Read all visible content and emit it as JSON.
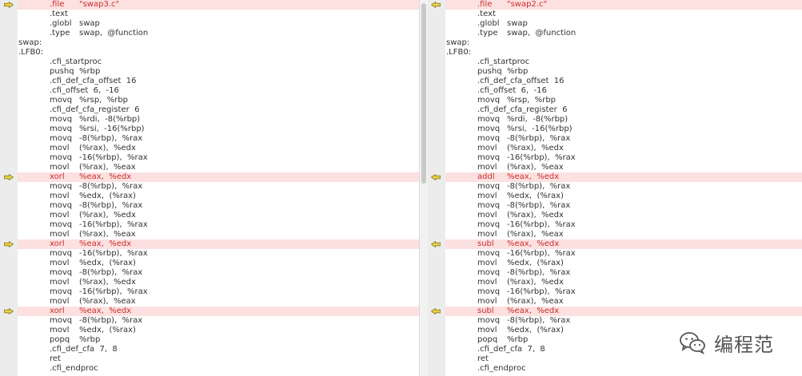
{
  "left_pane": {
    "lines": [
      {
        "l": "",
        "m": ".file",
        "o": "\"swap3.c\"",
        "diff": true
      },
      {
        "l": "",
        "m": ".text",
        "o": "",
        "diff": false
      },
      {
        "l": "",
        "m": ".globl",
        "o": "swap",
        "diff": false
      },
      {
        "l": "",
        "m": ".type",
        "o": "swap,  @function",
        "diff": false
      },
      {
        "l": "swap:",
        "m": "",
        "o": "",
        "diff": false
      },
      {
        "l": ".LFB0:",
        "m": "",
        "o": "",
        "diff": false
      },
      {
        "l": "",
        "m": ".cfi_startproc",
        "o": "",
        "diff": false
      },
      {
        "l": "",
        "m": "pushq",
        "o": "%rbp",
        "diff": false
      },
      {
        "l": "",
        "m": ".cfi_def_cfa_offset  16",
        "o": "",
        "diff": false
      },
      {
        "l": "",
        "m": ".cfi_offset  6,  -16",
        "o": "",
        "diff": false
      },
      {
        "l": "",
        "m": "movq",
        "o": "%rsp,  %rbp",
        "diff": false
      },
      {
        "l": "",
        "m": ".cfi_def_cfa_register  6",
        "o": "",
        "diff": false
      },
      {
        "l": "",
        "m": "movq",
        "o": "%rdi,  -8(%rbp)",
        "diff": false
      },
      {
        "l": "",
        "m": "movq",
        "o": "%rsi,  -16(%rbp)",
        "diff": false
      },
      {
        "l": "",
        "m": "movq",
        "o": "-8(%rbp),  %rax",
        "diff": false
      },
      {
        "l": "",
        "m": "movl",
        "o": "(%rax),  %edx",
        "diff": false
      },
      {
        "l": "",
        "m": "movq",
        "o": "-16(%rbp),  %rax",
        "diff": false
      },
      {
        "l": "",
        "m": "movl",
        "o": "(%rax),  %eax",
        "diff": false
      },
      {
        "l": "",
        "m": "xorl",
        "o": "%eax,  %edx",
        "diff": true
      },
      {
        "l": "",
        "m": "movq",
        "o": "-8(%rbp),  %rax",
        "diff": false
      },
      {
        "l": "",
        "m": "movl",
        "o": "%edx,  (%rax)",
        "diff": false
      },
      {
        "l": "",
        "m": "movq",
        "o": "-8(%rbp),  %rax",
        "diff": false
      },
      {
        "l": "",
        "m": "movl",
        "o": "(%rax),  %edx",
        "diff": false
      },
      {
        "l": "",
        "m": "movq",
        "o": "-16(%rbp),  %rax",
        "diff": false
      },
      {
        "l": "",
        "m": "movl",
        "o": "(%rax),  %eax",
        "diff": false
      },
      {
        "l": "",
        "m": "xorl",
        "o": "%eax,  %edx",
        "diff": true
      },
      {
        "l": "",
        "m": "movq",
        "o": "-16(%rbp),  %rax",
        "diff": false
      },
      {
        "l": "",
        "m": "movl",
        "o": "%edx,  (%rax)",
        "diff": false
      },
      {
        "l": "",
        "m": "movq",
        "o": "-8(%rbp),  %rax",
        "diff": false
      },
      {
        "l": "",
        "m": "movl",
        "o": "(%rax),  %edx",
        "diff": false
      },
      {
        "l": "",
        "m": "movq",
        "o": "-16(%rbp),  %rax",
        "diff": false
      },
      {
        "l": "",
        "m": "movl",
        "o": "(%rax),  %eax",
        "diff": false
      },
      {
        "l": "",
        "m": "xorl",
        "o": "%eax,  %edx",
        "diff": true
      },
      {
        "l": "",
        "m": "movq",
        "o": "-8(%rbp),  %rax",
        "diff": false
      },
      {
        "l": "",
        "m": "movl",
        "o": "%edx,  (%rax)",
        "diff": false
      },
      {
        "l": "",
        "m": "popq",
        "o": "%rbp",
        "diff": false
      },
      {
        "l": "",
        "m": ".cfi_def_cfa  7,  8",
        "o": "",
        "diff": false
      },
      {
        "l": "",
        "m": "ret",
        "o": "",
        "diff": false
      },
      {
        "l": "",
        "m": ".cfi_endproc",
        "o": "",
        "diff": false
      }
    ]
  },
  "right_pane": {
    "lines": [
      {
        "l": "",
        "m": ".file",
        "o": "\"swap2.c\"",
        "diff": true
      },
      {
        "l": "",
        "m": ".text",
        "o": "",
        "diff": false
      },
      {
        "l": "",
        "m": ".globl",
        "o": "swap",
        "diff": false
      },
      {
        "l": "",
        "m": ".type",
        "o": "swap,  @function",
        "diff": false
      },
      {
        "l": "swap:",
        "m": "",
        "o": "",
        "diff": false
      },
      {
        "l": ".LFB0:",
        "m": "",
        "o": "",
        "diff": false
      },
      {
        "l": "",
        "m": ".cfi_startproc",
        "o": "",
        "diff": false
      },
      {
        "l": "",
        "m": "pushq",
        "o": "%rbp",
        "diff": false
      },
      {
        "l": "",
        "m": ".cfi_def_cfa_offset  16",
        "o": "",
        "diff": false
      },
      {
        "l": "",
        "m": ".cfi_offset  6,  -16",
        "o": "",
        "diff": false
      },
      {
        "l": "",
        "m": "movq",
        "o": "%rsp,  %rbp",
        "diff": false
      },
      {
        "l": "",
        "m": ".cfi_def_cfa_register  6",
        "o": "",
        "diff": false
      },
      {
        "l": "",
        "m": "movq",
        "o": "%rdi,  -8(%rbp)",
        "diff": false
      },
      {
        "l": "",
        "m": "movq",
        "o": "%rsi,  -16(%rbp)",
        "diff": false
      },
      {
        "l": "",
        "m": "movq",
        "o": "-8(%rbp),  %rax",
        "diff": false
      },
      {
        "l": "",
        "m": "movl",
        "o": "(%rax),  %edx",
        "diff": false
      },
      {
        "l": "",
        "m": "movq",
        "o": "-16(%rbp),  %rax",
        "diff": false
      },
      {
        "l": "",
        "m": "movl",
        "o": "(%rax),  %eax",
        "diff": false
      },
      {
        "l": "",
        "m": "addl",
        "o": "%eax,  %edx",
        "diff": true
      },
      {
        "l": "",
        "m": "movq",
        "o": "-8(%rbp),  %rax",
        "diff": false
      },
      {
        "l": "",
        "m": "movl",
        "o": "%edx,  (%rax)",
        "diff": false
      },
      {
        "l": "",
        "m": "movq",
        "o": "-8(%rbp),  %rax",
        "diff": false
      },
      {
        "l": "",
        "m": "movl",
        "o": "(%rax),  %edx",
        "diff": false
      },
      {
        "l": "",
        "m": "movq",
        "o": "-16(%rbp),  %rax",
        "diff": false
      },
      {
        "l": "",
        "m": "movl",
        "o": "(%rax),  %eax",
        "diff": false
      },
      {
        "l": "",
        "m": "subl",
        "o": "%eax,  %edx",
        "diff": true
      },
      {
        "l": "",
        "m": "movq",
        "o": "-16(%rbp),  %rax",
        "diff": false
      },
      {
        "l": "",
        "m": "movl",
        "o": "%edx,  (%rax)",
        "diff": false
      },
      {
        "l": "",
        "m": "movq",
        "o": "-8(%rbp),  %rax",
        "diff": false
      },
      {
        "l": "",
        "m": "movl",
        "o": "(%rax),  %edx",
        "diff": false
      },
      {
        "l": "",
        "m": "movq",
        "o": "-16(%rbp),  %rax",
        "diff": false
      },
      {
        "l": "",
        "m": "movl",
        "o": "(%rax),  %eax",
        "diff": false
      },
      {
        "l": "",
        "m": "subl",
        "o": "%eax,  %edx",
        "diff": true
      },
      {
        "l": "",
        "m": "movq",
        "o": "-8(%rbp),  %rax",
        "diff": false
      },
      {
        "l": "",
        "m": "movl",
        "o": "%edx,  (%rax)",
        "diff": false
      },
      {
        "l": "",
        "m": "popq",
        "o": "%rbp",
        "diff": false
      },
      {
        "l": "",
        "m": ".cfi_def_cfa  7,  8",
        "o": "",
        "diff": false
      },
      {
        "l": "",
        "m": "ret",
        "o": "",
        "diff": false
      },
      {
        "l": "",
        "m": ".cfi_endproc",
        "o": "",
        "diff": false
      }
    ]
  },
  "markers": {
    "left_icon": "arrow-right-icon",
    "right_icon": "arrow-left-icon",
    "color": "#e8d24a"
  },
  "colors": {
    "diff_background": "#fde0e0",
    "diff_text": "#c8302c"
  },
  "watermark": {
    "icon": "wechat-icon",
    "text": "编程范"
  }
}
